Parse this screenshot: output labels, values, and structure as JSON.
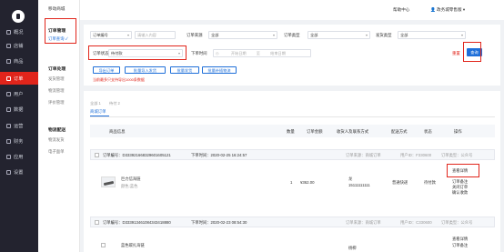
{
  "sidebar": {
    "items": [
      {
        "label": "概况",
        "icon": "home-icon"
      },
      {
        "label": "店铺",
        "icon": "store-icon"
      },
      {
        "label": "商品",
        "icon": "goods-icon"
      },
      {
        "label": "订单",
        "icon": "order-icon"
      },
      {
        "label": "用户",
        "icon": "user-icon"
      },
      {
        "label": "数据",
        "icon": "data-icon"
      },
      {
        "label": "运营",
        "icon": "operation-icon"
      },
      {
        "label": "财务",
        "icon": "finance-icon"
      },
      {
        "label": "应用",
        "icon": "apps-icon"
      },
      {
        "label": "设置",
        "icon": "settings-icon"
      }
    ],
    "active_index": 3
  },
  "subnav": {
    "app_title": "移动商城",
    "groups": [
      {
        "title": "订单管理",
        "links": [
          "订单查询"
        ]
      },
      {
        "title": "订单处理",
        "links": [
          "发货管理",
          "物流管理",
          "评价管理"
        ]
      },
      {
        "title": "物流配送",
        "links": [
          "物流发货",
          "电子面单"
        ]
      }
    ],
    "active_link": "订单查询"
  },
  "topbar": {
    "help": "帮助中心",
    "account": "政务城零售版",
    "account_icon": "user-icon"
  },
  "filters": {
    "row1": [
      {
        "label": "订单编号",
        "type": "select"
      },
      {
        "label": "",
        "type": "input",
        "placeholder": "请输入内容"
      },
      {
        "label": "订单来源",
        "type": "select",
        "value": "全部"
      },
      {
        "label": "订单类型",
        "type": "select",
        "value": "全部"
      },
      {
        "label": "发货类型",
        "type": "select",
        "value": "全部"
      }
    ],
    "order_status_label": "订单状态",
    "order_status_value": "待付款",
    "order_time_label": "下单时间",
    "start_date_placeholder": "开始日期",
    "end_date_placeholder": "结束日期",
    "date_separator": "至",
    "reset": "重置",
    "search": "查询"
  },
  "actions": {
    "buttons": [
      "导出订单",
      "批量导入发货",
      "批量发货",
      "批量补插物流"
    ],
    "warning": "当前最多只支持导出1000条数据"
  },
  "tabs": {
    "items": [
      {
        "label": "全部 1"
      },
      {
        "label": "待付 2"
      }
    ],
    "channel": "商城订单"
  },
  "table": {
    "headers": [
      "商品信息",
      "数量",
      "订单金额",
      "收货人及联系方式",
      "配送方式",
      "状态",
      "操作"
    ],
    "orders": [
      {
        "no_label": "订单编号：D333921668329601605121",
        "time_label": "下单时间：2020-02-25 16:24:57",
        "source": "订单来源：商城订单",
        "user_id": "用户ID：F330600",
        "type": "订单类型：公众号",
        "product": "巨力信海链",
        "spec": "颜色:蓝色",
        "qty": "1",
        "amount": "¥362.00",
        "receiver": "龙",
        "phone": "15111111111",
        "delivery": "普通快递",
        "status": "待付款",
        "ops": [
          "查看详情",
          "订单备注",
          "关闭订单",
          "确认收款"
        ]
      },
      {
        "no_label": "订单编号：D333913461084343418880",
        "time_label": "下单时间：2020-02-23 08:54:30",
        "source": "订单来源：商城订单",
        "user_id": "用户ID：C330600",
        "type": "订单类型：公众号",
        "product": "蓝色碳扎海链",
        "spec": "",
        "qty": "",
        "amount": "",
        "receiver": "杨柳",
        "phone": "",
        "delivery": "",
        "status": "",
        "ops": [
          "查看详情",
          "订单备注"
        ]
      }
    ]
  },
  "colors": {
    "accent": "#e1251b",
    "primary": "#1e6fd9",
    "sidebar_bg": "#23232f"
  }
}
